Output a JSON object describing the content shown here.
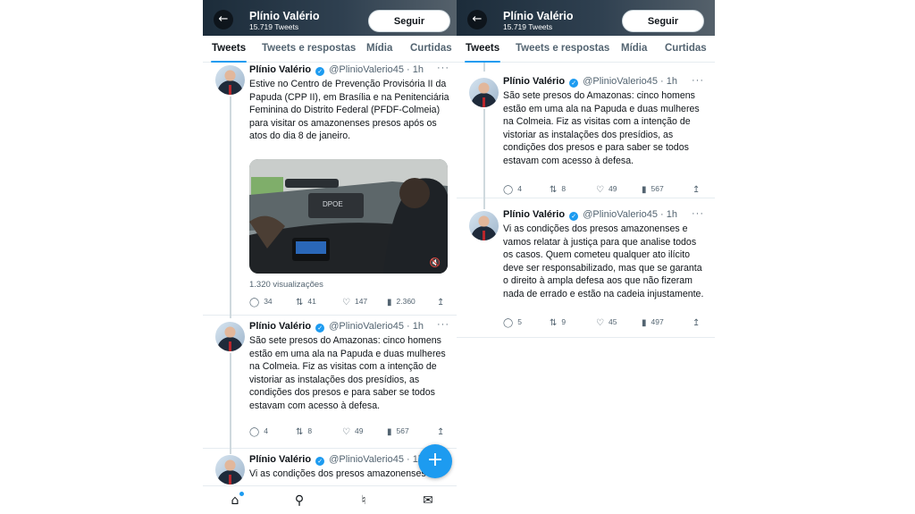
{
  "profile": {
    "name": "Plínio Valério",
    "tweet_count": "15.719 Tweets",
    "follow_label": "Seguir"
  },
  "tabs": [
    "Tweets",
    "Tweets e respostas",
    "Mídia",
    "Curtidas"
  ],
  "author": {
    "name": "Plínio Valério",
    "handle": "@PlinioValerio45",
    "time": "· 1h"
  },
  "tweets": [
    {
      "text": "Estive no Centro de Prevenção Provisória II da Papuda (CPP II), em Brasília e na Penitenciária Feminina do Distrito Federal (PFDF-Colmeia) para visitar os amazonenses presos após os atos do dia 8 de janeiro.",
      "views": "1.320 visualizações",
      "media_text": "DPOE",
      "replies": "34",
      "retweets": "41",
      "likes": "147",
      "analytics": "2.360"
    },
    {
      "text": "São sete presos do Amazonas: cinco homens estão em uma ala na Papuda e duas mulheres na Colmeia.  Fiz as visitas com a intenção de vistoriar as instalações dos presídios, as condições dos presos e para saber se todos estavam com acesso à defesa.",
      "replies": "4",
      "retweets": "8",
      "likes": "49",
      "analytics": "567"
    },
    {
      "text": "Vi as condições dos presos amazonenses e vamos relatar à justiça para que analise todos os casos. Quem cometeu qualquer ato ilícito deve ser responsabilizado, mas que se garanta o direito à ampla defesa aos que não fizeram nada de errado e estão na cadeia injustamente.",
      "text_truncated": "Vi as condições dos presos amazonenses",
      "replies": "5",
      "retweets": "9",
      "likes": "45",
      "analytics": "497"
    }
  ],
  "icons": {
    "back": "arrow-left-icon",
    "reply": "reply-icon",
    "retweet": "retweet-icon",
    "like": "heart-icon",
    "analytics": "analytics-icon",
    "share": "share-icon",
    "more": "more-icon",
    "verified": "verified-badge-icon",
    "home": "home-icon",
    "search": "search-icon",
    "notifications": "bell-icon",
    "messages": "mail-icon",
    "compose": "compose-icon",
    "mute": "mute-icon"
  },
  "colors": {
    "accent": "#1d9bf0",
    "text": "#0f1419",
    "secondary": "#536471"
  }
}
